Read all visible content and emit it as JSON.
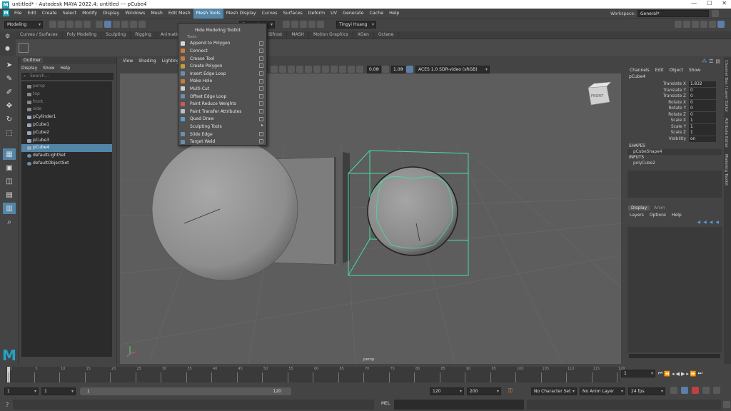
{
  "window": {
    "title": "untitled* - Autodesk MAYA 2022.4: untitled   ---   pCube4",
    "minimize": "—",
    "maximize": "☐",
    "close": "✕"
  },
  "menubar": {
    "logo": "M",
    "items": [
      "File",
      "Edit",
      "Create",
      "Select",
      "Modify",
      "Display",
      "Windows",
      "Mesh",
      "Edit Mesh",
      "Mesh Tools",
      "Mesh Display",
      "Curves",
      "Surfaces",
      "Deform",
      "UV",
      "Generate",
      "Cache",
      "Help"
    ],
    "active": "Mesh Tools",
    "workspace_label": "Workspace:",
    "workspace_value": "General*"
  },
  "statusline": {
    "mode": "Modeling",
    "symmetry": "Symmetry: Off",
    "user": "Tingyi Huang"
  },
  "shelf": {
    "tabs": [
      "Curves / Surfaces",
      "Poly Modeling",
      "Sculpting",
      "Rigging",
      "Animation",
      "",
      "",
      "",
      "Arnold",
      "Bifrost",
      "MASH",
      "Motion Graphics",
      "XGen",
      "Octane"
    ]
  },
  "outliner": {
    "title": "Outliner",
    "menu": [
      "Display",
      "Show",
      "Help"
    ],
    "search_placeholder": "Search...",
    "items": [
      {
        "label": "persp",
        "kind": "camera",
        "dim": true
      },
      {
        "label": "top",
        "kind": "camera",
        "dim": true
      },
      {
        "label": "front",
        "kind": "camera",
        "dim": true
      },
      {
        "label": "side",
        "kind": "camera",
        "dim": true
      },
      {
        "label": "pCylinder1",
        "kind": "mesh",
        "dim": false
      },
      {
        "label": "pCube1",
        "kind": "mesh",
        "dim": false
      },
      {
        "label": "pCube2",
        "kind": "mesh",
        "dim": false
      },
      {
        "label": "pCube3",
        "kind": "mesh",
        "dim": false
      },
      {
        "label": "pCube4",
        "kind": "mesh",
        "dim": false,
        "selected": true
      },
      {
        "label": "defaultLightSet",
        "kind": "set",
        "dim": false
      },
      {
        "label": "defaultObjectSet",
        "kind": "set",
        "dim": false
      }
    ]
  },
  "viewport": {
    "menu": [
      "View",
      "Shading",
      "Lighting"
    ],
    "field1": "0.00",
    "field2": "1.00",
    "colorspace": "ACES 1.0 SDR-video (sRGB)",
    "camera_label": "persp",
    "cube_label": "FRONT"
  },
  "dropdown": {
    "items": [
      {
        "label": "Hide Modeling Toolkit",
        "type": "plain"
      },
      {
        "label": "Tools",
        "type": "section"
      },
      {
        "label": "Append to Polygon",
        "type": "box",
        "color": "#d9d9d9"
      },
      {
        "label": "Connect",
        "type": "box",
        "color": "#d07a3a"
      },
      {
        "label": "Crease Tool",
        "type": "box",
        "color": "#c87b35"
      },
      {
        "label": "Create Polygon",
        "type": "box",
        "color": "#c89a3a"
      },
      {
        "label": "Insert Edge Loop",
        "type": "box",
        "color": "#6a8fb0"
      },
      {
        "label": "Make Hole",
        "type": "box",
        "color": "#c87b35"
      },
      {
        "label": "Multi-Cut",
        "type": "box",
        "color": "#d0d0d0"
      },
      {
        "label": "Offset Edge Loop",
        "type": "box",
        "color": "#6a8fb0"
      },
      {
        "label": "Paint Reduce Weights",
        "type": "box",
        "color": "#c85a5a"
      },
      {
        "label": "Paint Transfer Attributes",
        "type": "box",
        "color": "#c0c0c0"
      },
      {
        "label": "Quad Draw",
        "type": "box",
        "color": "#5aa0c8"
      },
      {
        "label": "Sculpting Tools",
        "type": "sub",
        "color": ""
      },
      {
        "label": "Slide Edge",
        "type": "box",
        "color": "#6a8fb0"
      },
      {
        "label": "Target Weld",
        "type": "box",
        "color": "#6a8fb0"
      }
    ]
  },
  "channelbox": {
    "menu": [
      "Channels",
      "Edit",
      "Object",
      "Show"
    ],
    "object": "pCube4",
    "attrs": [
      {
        "name": "Translate X",
        "value": "1.832"
      },
      {
        "name": "Translate Y",
        "value": "0"
      },
      {
        "name": "Translate Z",
        "value": "0"
      },
      {
        "name": "Rotate X",
        "value": "0"
      },
      {
        "name": "Rotate Y",
        "value": "0"
      },
      {
        "name": "Rotate Z",
        "value": "0"
      },
      {
        "name": "Scale X",
        "value": "1"
      },
      {
        "name": "Scale Y",
        "value": "1"
      },
      {
        "name": "Scale Z",
        "value": "1"
      },
      {
        "name": "Visibility",
        "value": "on"
      }
    ],
    "shapes_label": "SHAPES",
    "shape": "pCubeShape4",
    "inputs_label": "INPUTS",
    "input": "polyCube2"
  },
  "sidetabs": [
    "Channel Box / Layer Editor",
    "Attribute Editor",
    "Modeling Toolkit"
  ],
  "layers": {
    "tabs": [
      "Display",
      "Anim"
    ],
    "menu": [
      "Layers",
      "Options",
      "Help"
    ]
  },
  "timeslider": {
    "ticks": [
      "1",
      "5",
      "10",
      "15",
      "20",
      "25",
      "30",
      "35",
      "40",
      "45",
      "50",
      "55",
      "60",
      "65",
      "70",
      "75",
      "80",
      "85",
      "90",
      "95",
      "100",
      "105",
      "110",
      "115",
      "120"
    ],
    "current_frame": "1"
  },
  "range": {
    "start": "1",
    "playback_start": "1",
    "slider_start": "1",
    "slider_end": "120",
    "playback_end": "120",
    "end": "200",
    "character_set": "No Character Set",
    "anim_layer": "No Anim Layer",
    "fps": "24 fps"
  },
  "cmdline": {
    "lang": "MEL"
  }
}
